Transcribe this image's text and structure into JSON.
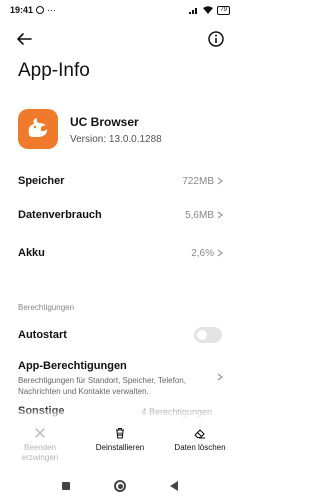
{
  "status_bar": {
    "time": "19:41",
    "dots": "···",
    "battery": "79"
  },
  "header": {
    "title": "App-Info"
  },
  "app": {
    "name": "UC Browser",
    "version": "Version: 13.0.0.1288"
  },
  "rows": [
    {
      "label": "Speicher",
      "value": "722MB"
    },
    {
      "label": "Datenverbrauch",
      "value": "5,6MB"
    },
    {
      "label": "Akku",
      "value": "2,6%"
    }
  ],
  "permissions": {
    "section_title": "Berechtigungen",
    "autostart_label": "Autostart",
    "autostart_enabled": false,
    "app_permissions_title": "App-Berechtigungen",
    "app_permissions_desc": "Berechtigungen für Standort, Speicher, Telefon, Nachrichten und Kontakte verwalten.",
    "other_label": "Sonstige",
    "other_value": "4 Berechtigungen"
  },
  "actions": [
    {
      "label": "Beenden erzwingen",
      "icon": "close-icon",
      "enabled": false
    },
    {
      "label": "Deinstallieren",
      "icon": "trash-icon",
      "enabled": true
    },
    {
      "label": "Daten löschen",
      "icon": "eraser-icon",
      "enabled": true
    }
  ],
  "colors": {
    "brand": "#f07a2b",
    "muted": "#888888",
    "disabled": "#b5b5b5"
  }
}
